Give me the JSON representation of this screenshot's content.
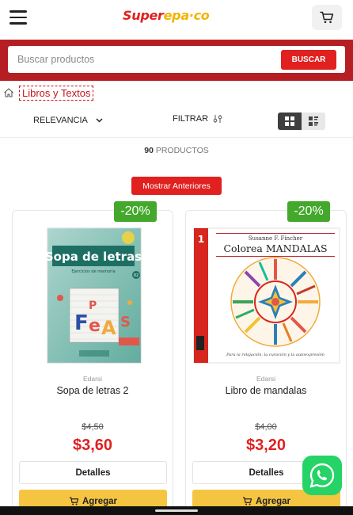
{
  "header": {
    "logo_part1": "Super",
    "logo_part2": "epa",
    "logo_part3": "·co",
    "menu_icon": "hamburger-icon",
    "cart_icon": "cart-icon"
  },
  "search": {
    "placeholder": "Buscar productos",
    "button_label": "BUSCAR"
  },
  "breadcrumb": {
    "home_icon": "home-icon",
    "current": "Libros y Textos"
  },
  "toolbar": {
    "sort_label": "RELEVANCIA",
    "filter_label": "FILTRAR",
    "view_grid_icon": "grid-view-icon",
    "view_list_icon": "list-view-icon"
  },
  "results": {
    "count": "90",
    "count_label": "PRODUCTOS"
  },
  "pagination": {
    "prev_label": "Mostrar Anteriores"
  },
  "products": [
    {
      "discount": "-20%",
      "brand": "Edarsi",
      "name": "Sopa de letras 2",
      "old_price": "$4,50",
      "new_price": "$3,60",
      "details_label": "Detalles",
      "add_label": "Agregar",
      "cover_title": "Sopa de letras",
      "cover_subtitle": "Ejercicios de memoria",
      "cover_badge": "02"
    },
    {
      "discount": "-20%",
      "brand": "Edarsi",
      "name": "Libro de mandalas",
      "old_price": "$4,00",
      "new_price": "$3,20",
      "details_label": "Detalles",
      "add_label": "Agregar",
      "cover_author": "Susanne F. Fincher",
      "cover_title": "Colorea MANDALAS",
      "cover_tagline": "Para la relajación, la curación y la autoexpresión",
      "cover_spine": "1"
    }
  ],
  "colors": {
    "brand_red": "#e0211f",
    "band_red": "#b51f24",
    "badge_green": "#43a82b",
    "button_yellow": "#f5c542",
    "whatsapp_green": "#25d366"
  },
  "floating": {
    "whatsapp_icon": "whatsapp-icon"
  }
}
